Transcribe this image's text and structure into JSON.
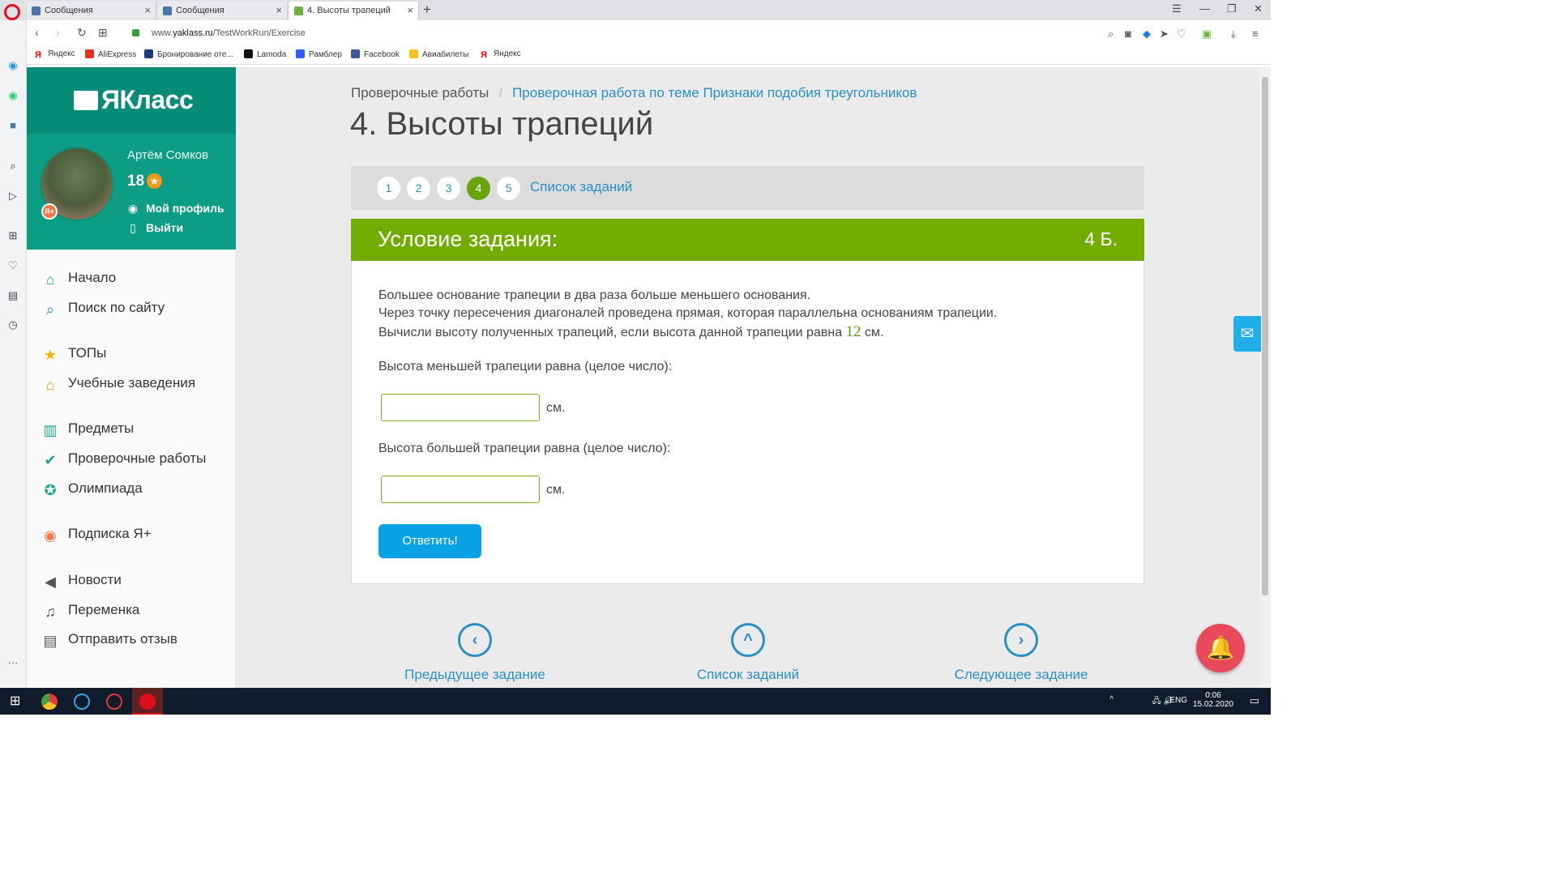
{
  "browser": {
    "tabs": [
      {
        "label": "Сообщения",
        "icon": "vk-icon"
      },
      {
        "label": "Сообщения",
        "icon": "vk-icon"
      },
      {
        "label": "4. Высоты трапеций",
        "icon": "yaklass-icon",
        "active": true
      }
    ],
    "url_prefix": "www.",
    "url_host": "yaklass.ru",
    "url_path": "/TestWorkRun/Exercise",
    "bookmarks": [
      "Яндекс",
      "AliExpress",
      "Бронирование оте...",
      "Lamoda",
      "Рамблер",
      "Facebook",
      "Авиабилеты",
      "Яндекс"
    ]
  },
  "sidebar": {
    "logo_text": "ЯКласс",
    "user_name": "Артём Сомков",
    "score": "18",
    "profile_link": "Мой профиль",
    "logout_link": "Выйти",
    "menu": [
      {
        "label": "Начало",
        "icon": "home-icon"
      },
      {
        "label": "Поиск по сайту",
        "icon": "search-icon"
      },
      {
        "label": "ТОПы",
        "icon": "star-icon"
      },
      {
        "label": "Учебные заведения",
        "icon": "institution-icon"
      },
      {
        "label": "Предметы",
        "icon": "book-icon"
      },
      {
        "label": "Проверочные работы",
        "icon": "check-circle-icon"
      },
      {
        "label": "Олимпиада",
        "icon": "medal-icon"
      },
      {
        "label": "Подписка Я+",
        "icon": "subscription-icon"
      },
      {
        "label": "Новости",
        "icon": "megaphone-icon"
      },
      {
        "label": "Переменка",
        "icon": "bell-icon"
      },
      {
        "label": "Отправить отзыв",
        "icon": "feedback-icon"
      }
    ]
  },
  "main": {
    "breadcrumb": [
      "Проверочные работы",
      "/",
      "Проверочная работа по теме Признаки подобия треугольников"
    ],
    "title": "4. Высоты трапеций",
    "task_numbers": [
      "1",
      "2",
      "3",
      "4",
      "5"
    ],
    "active_task": "4",
    "task_list_link": "Список заданий",
    "condition_title": "Условие задания:",
    "points": "4 Б.",
    "problem": {
      "line1": "Большее основание трапеции в два раза больше меньшего основания.",
      "line2": "Через точку пересечения диагоналей проведена прямая, которая параллельна основаниям трапеции.",
      "line3_start": "Вычисли высоту полученных трапеций, если высота данной трапеции равна ",
      "line3_value": "12",
      "line3_end": " см."
    },
    "question1": "Высота меньшей трапеции равна (целое число):",
    "question2": "Высота большей трапеции равна (целое число):",
    "answer1_value": "",
    "answer2_value": "",
    "unit": "см.",
    "submit_label": "Ответить!",
    "nav": {
      "prev": "Предыдущее задание",
      "list": "Список заданий",
      "next": "Следующее задание"
    }
  },
  "os": {
    "lang": "ENG",
    "time": "0:06",
    "date": "15.02.2020"
  },
  "colors": {
    "brand_green": "#078c77",
    "condition_green": "#72ac00",
    "link_blue": "#2a8fc2",
    "button_blue": "#0aa2e6"
  }
}
